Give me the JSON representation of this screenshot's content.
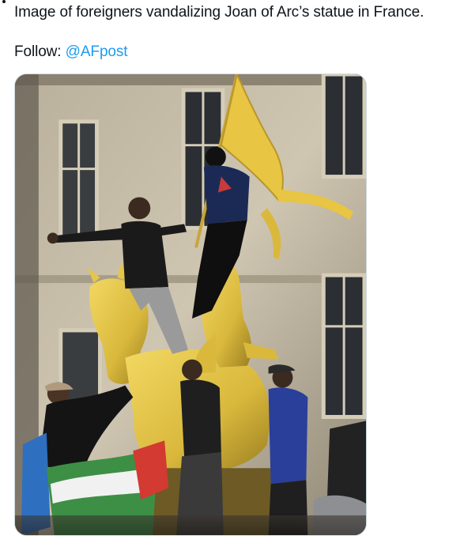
{
  "tweet": {
    "text_line": "Image of foreigners vandalizing Joan of Arc’s statue in France.",
    "follow_label": "Follow:",
    "mention": "@AFpost"
  },
  "media": {
    "type": "photo",
    "alt": "Image of foreigners vandalizing Joan of Arc’s statue in France.",
    "colors": {
      "wall": "#c9c0ad",
      "statue_gold": "#e3c64a",
      "flag_yellow": "#e8c542",
      "window_dark": "#2b2f33"
    }
  }
}
